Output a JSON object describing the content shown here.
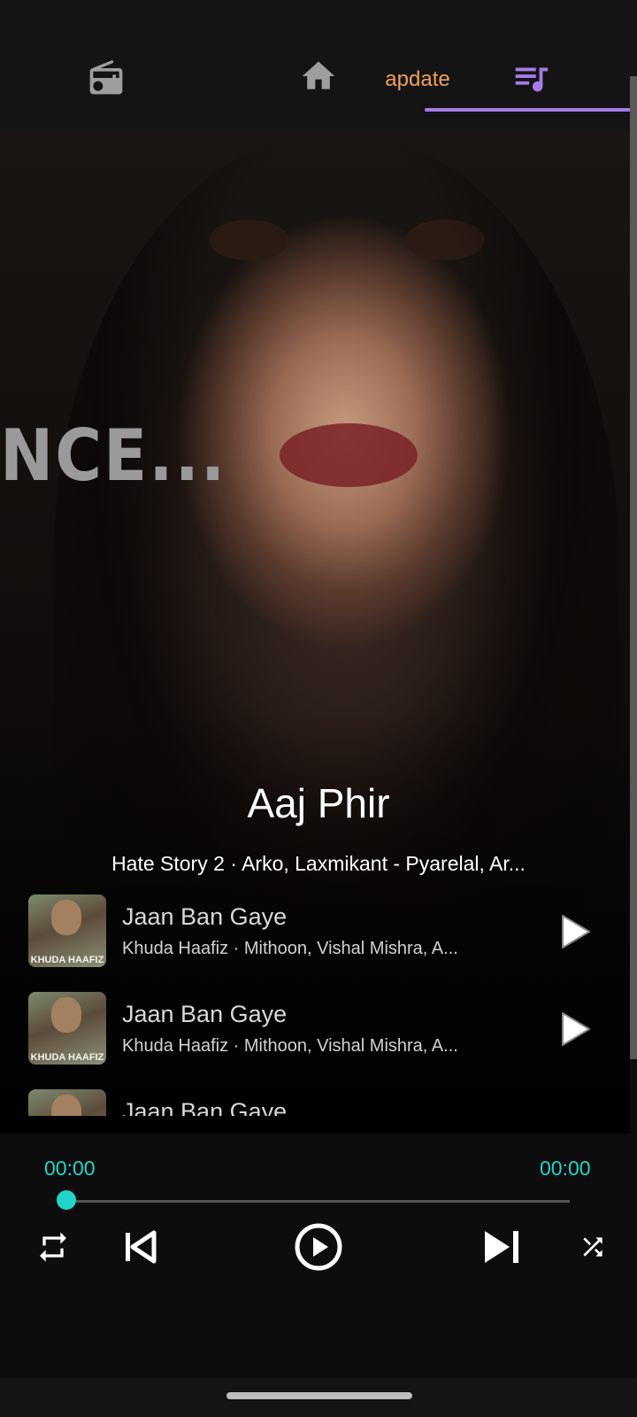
{
  "nav": {
    "tabs": [
      {
        "icon": "radio-icon",
        "label": ""
      },
      {
        "icon": "home-icon",
        "label": ""
      },
      {
        "icon": "",
        "label": "apdate"
      },
      {
        "icon": "queue-music-icon",
        "label": ""
      }
    ],
    "active_index": 3,
    "accent_color": "#a47ce6",
    "update_color": "#f0a05a"
  },
  "hero": {
    "poster_text": "NCE..."
  },
  "now_playing": {
    "title": "Aaj Phir",
    "subtitle": "Hate Story 2 · Arko, Laxmikant - Pyarelal, Ar..."
  },
  "queue": [
    {
      "title": "Jaan Ban Gaye",
      "meta": "Khuda Haafiz · Mithoon, Vishal Mishra, A...",
      "thumb_text": "KHUDA HAAFIZ"
    },
    {
      "title": "Jaan Ban Gaye",
      "meta": "Khuda Haafiz · Mithoon, Vishal Mishra, A...",
      "thumb_text": "KHUDA HAAFIZ"
    },
    {
      "title": "Jaan Ban Gaye",
      "meta": "",
      "thumb_text": ""
    }
  ],
  "player": {
    "current_time": "00:00",
    "total_time": "00:00",
    "progress": 0,
    "accent_color": "#1fd6c8",
    "controls": [
      "repeat-icon",
      "skip-previous-icon",
      "play-circle-icon",
      "skip-next-icon",
      "shuffle-icon"
    ]
  }
}
